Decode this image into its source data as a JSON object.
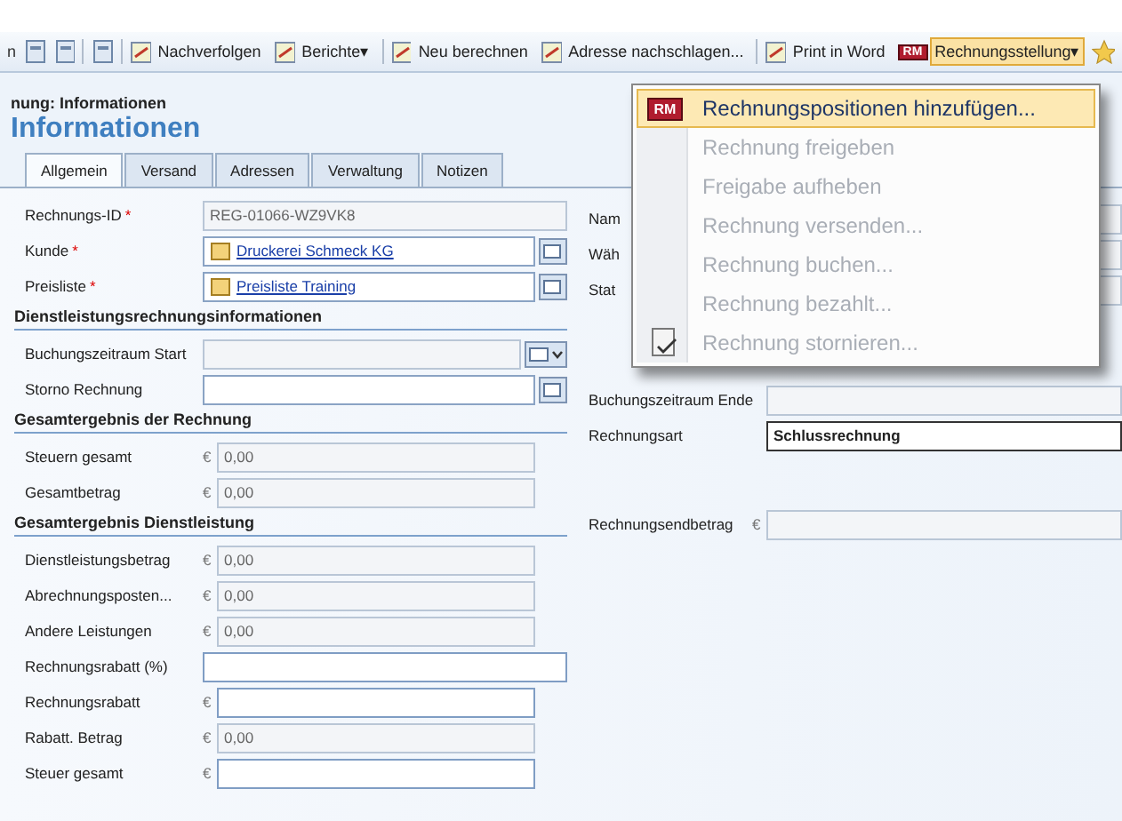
{
  "toolbar": {
    "items": [
      {
        "kind": "text",
        "label": "n"
      },
      {
        "kind": "icon"
      },
      {
        "kind": "icon"
      },
      {
        "kind": "sep"
      },
      {
        "kind": "icon"
      },
      {
        "kind": "sep"
      },
      {
        "kind": "button",
        "label": "Nachverfolgen",
        "expanded": false
      },
      {
        "kind": "button",
        "label": "Berichte",
        "caret": "▾",
        "expanded": false
      },
      {
        "kind": "sep"
      },
      {
        "kind": "button",
        "label": "Neu berechnen",
        "expanded": false
      },
      {
        "kind": "button",
        "label": "Adresse nachschlagen...",
        "expanded": false
      },
      {
        "kind": "sep"
      },
      {
        "kind": "button",
        "label": "Print in Word",
        "expanded": false
      },
      {
        "kind": "button",
        "label": "Rechnungsstellung",
        "badge": "RM",
        "caret": "▾",
        "expanded": true
      }
    ]
  },
  "breadcrumb": "nung: Informationen",
  "title": "Informationen",
  "tabs": [
    {
      "label": "Allgemein",
      "selected": true
    },
    {
      "label": "Versand",
      "selected": false
    },
    {
      "label": "Adressen",
      "selected": false
    },
    {
      "label": "Verwaltung",
      "selected": false
    },
    {
      "label": "Notizen",
      "selected": false
    }
  ],
  "left": [
    {
      "kind": "field",
      "label": "Rechnungs-ID",
      "required_mark": "*",
      "value": "REG-01066-WZ9VK8",
      "disabled": true
    },
    {
      "kind": "lookup",
      "label": "Kunde",
      "required_mark": "*",
      "value": "Druckerei Schmeck KG"
    },
    {
      "kind": "lookup",
      "label": "Preisliste",
      "required_mark": "*",
      "value": "Preisliste Training"
    },
    {
      "kind": "section",
      "label": "Dienstleistungsrechnungsinformationen"
    },
    {
      "kind": "date",
      "label": "Buchungszeitraum Start"
    },
    {
      "kind": "lookup",
      "label": "Storno Rechnung"
    },
    {
      "kind": "section",
      "label": "Gesamtergebnis der Rechnung"
    },
    {
      "kind": "money",
      "label": "Steuern gesamt",
      "currency": "€",
      "value": "0,00",
      "disabled": true
    },
    {
      "kind": "money",
      "label": "Gesamtbetrag",
      "currency": "€",
      "value": "0,00",
      "disabled": true
    },
    {
      "kind": "section",
      "label": "Gesamtergebnis Dienstleistung"
    },
    {
      "kind": "money",
      "label": "Dienstleistungsbetrag",
      "currency": "€",
      "value": "0,00",
      "disabled": true
    },
    {
      "kind": "money",
      "label": "Abrechnungsposten...",
      "currency": "€",
      "value": "0,00",
      "disabled": true
    },
    {
      "kind": "money",
      "label": "Andere Leistungen",
      "currency": "€",
      "value": "0,00",
      "disabled": true
    },
    {
      "kind": "field",
      "label": "Rechnungsrabatt (%)",
      "disabled": false
    },
    {
      "kind": "money",
      "label": "Rechnungsrabatt",
      "currency": "€",
      "disabled": false
    },
    {
      "kind": "money",
      "label": "Rabatt. Betrag",
      "currency": "€",
      "value": "0,00",
      "disabled": true
    },
    {
      "kind": "money",
      "label": "Steuer gesamt",
      "currency": "€",
      "disabled": false
    }
  ],
  "right": [
    {
      "kind": "field",
      "label": "Nam"
    },
    {
      "kind": "field",
      "label": "Wäh"
    },
    {
      "kind": "field",
      "label": "Stat"
    },
    {
      "kind": "field",
      "label": "Buchungszeitraum Ende"
    },
    {
      "kind": "field",
      "label": "Rechnungsart",
      "value": "Schlussrechnung"
    },
    {
      "kind": "money",
      "label": "Rechnungsendbetrag",
      "currency": "€"
    }
  ],
  "menu": [
    {
      "label": "Rechnungspositionen hinzufügen...",
      "badge": "RM",
      "selected": true,
      "disabled": false
    },
    {
      "label": "Rechnung freigeben",
      "selected": false,
      "disabled": true
    },
    {
      "label": "Freigabe aufheben",
      "selected": false,
      "disabled": true
    },
    {
      "label": "Rechnung versenden...",
      "selected": false,
      "disabled": true
    },
    {
      "label": "Rechnung buchen...",
      "selected": false,
      "disabled": true
    },
    {
      "label": "Rechnung bezahlt...",
      "selected": false,
      "disabled": true
    },
    {
      "label": "Rechnung stornieren...",
      "selected": false,
      "disabled": true
    }
  ]
}
